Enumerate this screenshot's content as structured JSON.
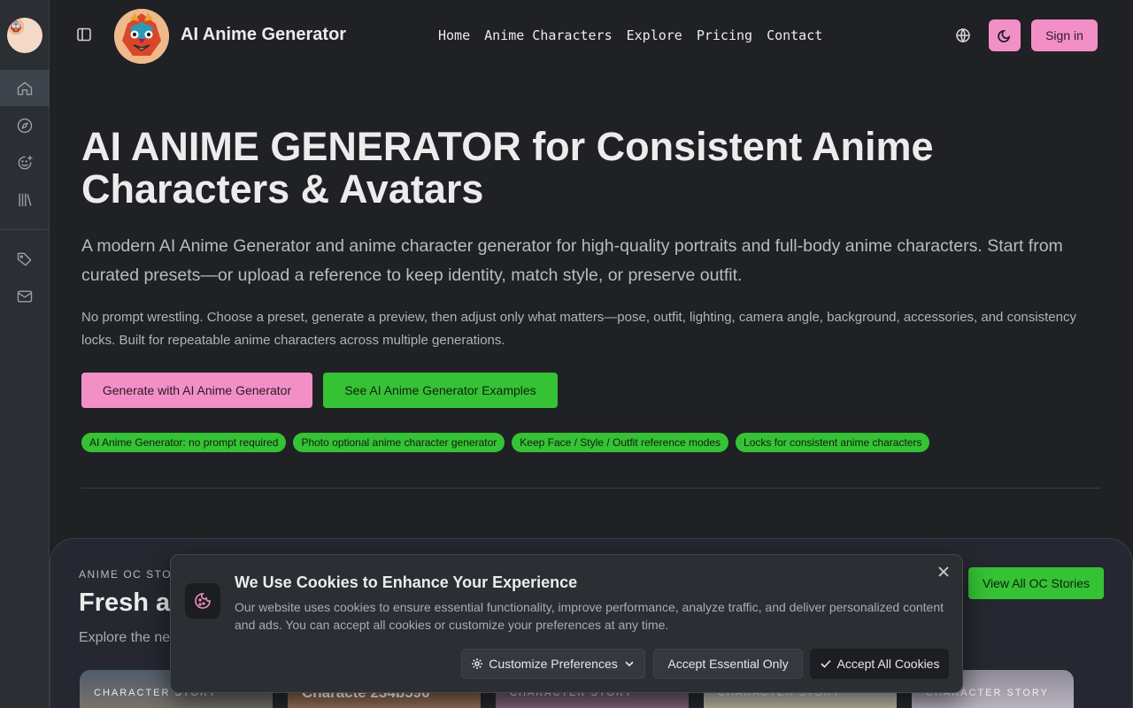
{
  "brand": {
    "name": "AI Anime Generator"
  },
  "nav": {
    "items": [
      "Home",
      "Anime Characters",
      "Explore",
      "Pricing",
      "Contact"
    ]
  },
  "header": {
    "signin_label": "Sign in"
  },
  "hero": {
    "title": "AI ANIME GENERATOR for Consistent Anime Characters & Avatars",
    "subtitle": "A modern AI Anime Generator and anime character generator for high-quality portraits and full-body anime characters. Start from curated presets—or upload a reference to keep identity, match style, or preserve outfit.",
    "description": "No prompt wrestling. Choose a preset, generate a preview, then adjust only what matters—pose, outfit, lighting, camera angle, background, accessories, and consistency locks. Built for repeatable anime characters across multiple generations.",
    "primary_cta": "Generate with AI Anime Generator",
    "secondary_cta": "See AI Anime Generator Examples",
    "tags": [
      "AI Anime Generator: no prompt required",
      "Photo optional anime character generator",
      "Keep Face / Style / Outfit reference modes",
      "Locks for consistent anime characters"
    ]
  },
  "stories": {
    "eyebrow": "ANIME OC STO",
    "title": "Fresh a",
    "subtitle": "Explore the ne",
    "view_all": "View All OC Stories",
    "cards": [
      {
        "label": "CHARACTER STORY"
      },
      {
        "label": "Characte 234b590"
      },
      {
        "label": "CHARACTER STORY"
      },
      {
        "label": "CHARACTER STORY"
      },
      {
        "label": "CHARACTER STORY"
      }
    ]
  },
  "cookie": {
    "title": "We Use Cookies to Enhance Your Experience",
    "body": "Our website uses cookies to ensure essential functionality, improve performance, analyze traffic, and deliver personalized content and ads. You can accept all cookies or customize your preferences at any time.",
    "customize": "Customize Preferences",
    "essential": "Accept Essential Only",
    "accept_all": "Accept All Cookies"
  },
  "colors": {
    "pink": "#f38fc7",
    "green": "#35c235",
    "background": "#1f2125"
  }
}
